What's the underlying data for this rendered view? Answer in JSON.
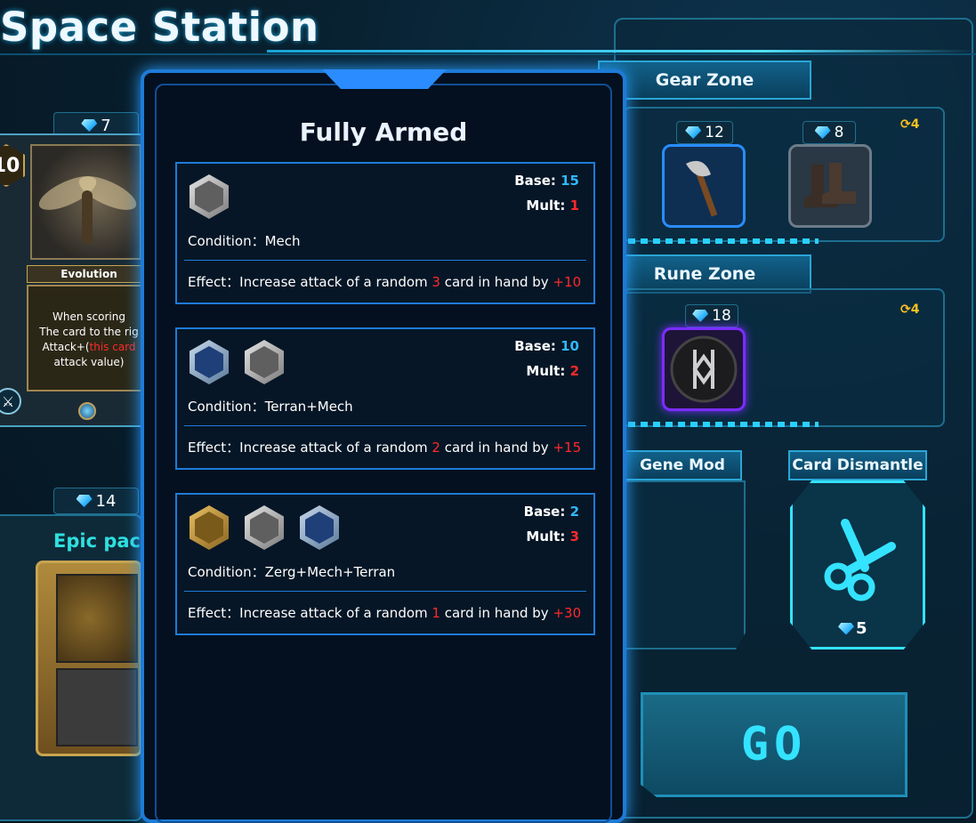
{
  "header": {
    "title": "Space Station"
  },
  "left_card": {
    "cost": "7",
    "level": "10",
    "name": "Evolution",
    "desc_line1": "When scoring",
    "desc_line2": "The card to the rig",
    "desc_line3a": "Attack+(",
    "desc_line3b": "this card",
    "desc_line4": "attack value)"
  },
  "pack": {
    "cost": "14",
    "title": "Epic pack"
  },
  "popup": {
    "title": "Fully Armed",
    "rules": [
      {
        "icons": [
          "grey"
        ],
        "base_label": "Base:",
        "base": "15",
        "mult_label": "Mult:",
        "mult": "1",
        "condition": "Condition：Mech",
        "effect_a": "Effect：Increase attack of a random ",
        "effect_n": "3",
        "effect_b": " card in hand by ",
        "effect_v": "+10"
      },
      {
        "icons": [
          "blue",
          "grey"
        ],
        "base_label": "Base:",
        "base": "10",
        "mult_label": "Mult:",
        "mult": "2",
        "condition": "Condition：Terran+Mech",
        "effect_a": "Effect：Increase attack of a random ",
        "effect_n": "2",
        "effect_b": " card in hand by ",
        "effect_v": "+15"
      },
      {
        "icons": [
          "gold",
          "grey",
          "blue"
        ],
        "base_label": "Base:",
        "base": "2",
        "mult_label": "Mult:",
        "mult": "3",
        "condition": "Condition：Zerg+Mech+Terran",
        "effect_a": "Effect：Increase attack of a random ",
        "effect_n": "1",
        "effect_b": " card in hand by ",
        "effect_v": "+30"
      }
    ]
  },
  "gear_zone": {
    "title": "Gear Zone",
    "refresh": "4",
    "items": [
      {
        "cost": "12",
        "icon": "axe-icon"
      },
      {
        "cost": "8",
        "icon": "boots-icon"
      }
    ]
  },
  "rune_zone": {
    "title": "Rune Zone",
    "refresh": "4",
    "items": [
      {
        "cost": "18",
        "icon": "rune-icon"
      }
    ]
  },
  "gene_mod": {
    "title": "Gene Mod"
  },
  "card_dismantle": {
    "title": "Card Dismantle",
    "cost": "5"
  },
  "go_button": {
    "label": "GO"
  },
  "colors": {
    "accent": "#1e7bd8",
    "cyan": "#34e3ff",
    "red": "#ff2a2a",
    "value_blue": "#2fb8ff",
    "gold": "#ffc021"
  }
}
